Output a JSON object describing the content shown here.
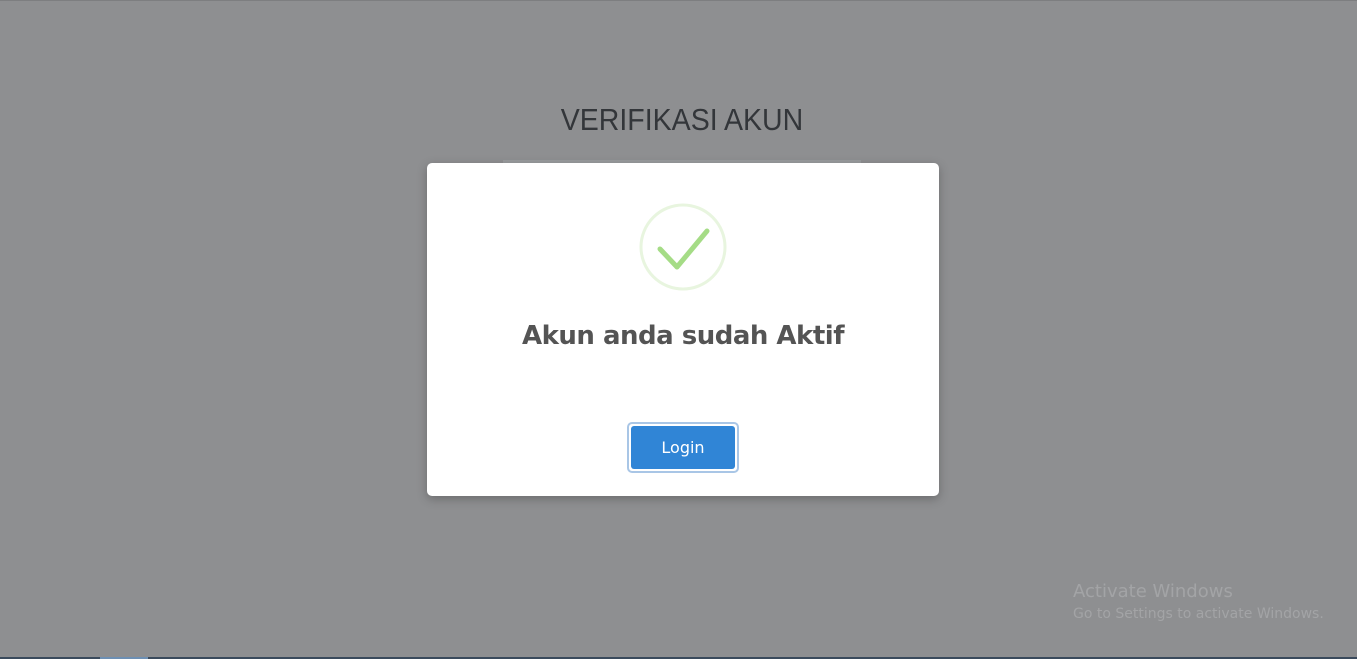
{
  "page": {
    "title": "VERIFIKASI AKUN"
  },
  "modal": {
    "icon": "checkmark-success-icon",
    "message": "Akun anda sudah Aktif",
    "login_label": "Login"
  },
  "watermark": {
    "title": "Activate Windows",
    "subtitle": "Go to Settings to activate Windows."
  },
  "colors": {
    "overlay": "#8e8f91",
    "success": "#a5dc86",
    "success_ring": "#e8f5df",
    "button": "#3085d6",
    "message_text": "#545454"
  }
}
